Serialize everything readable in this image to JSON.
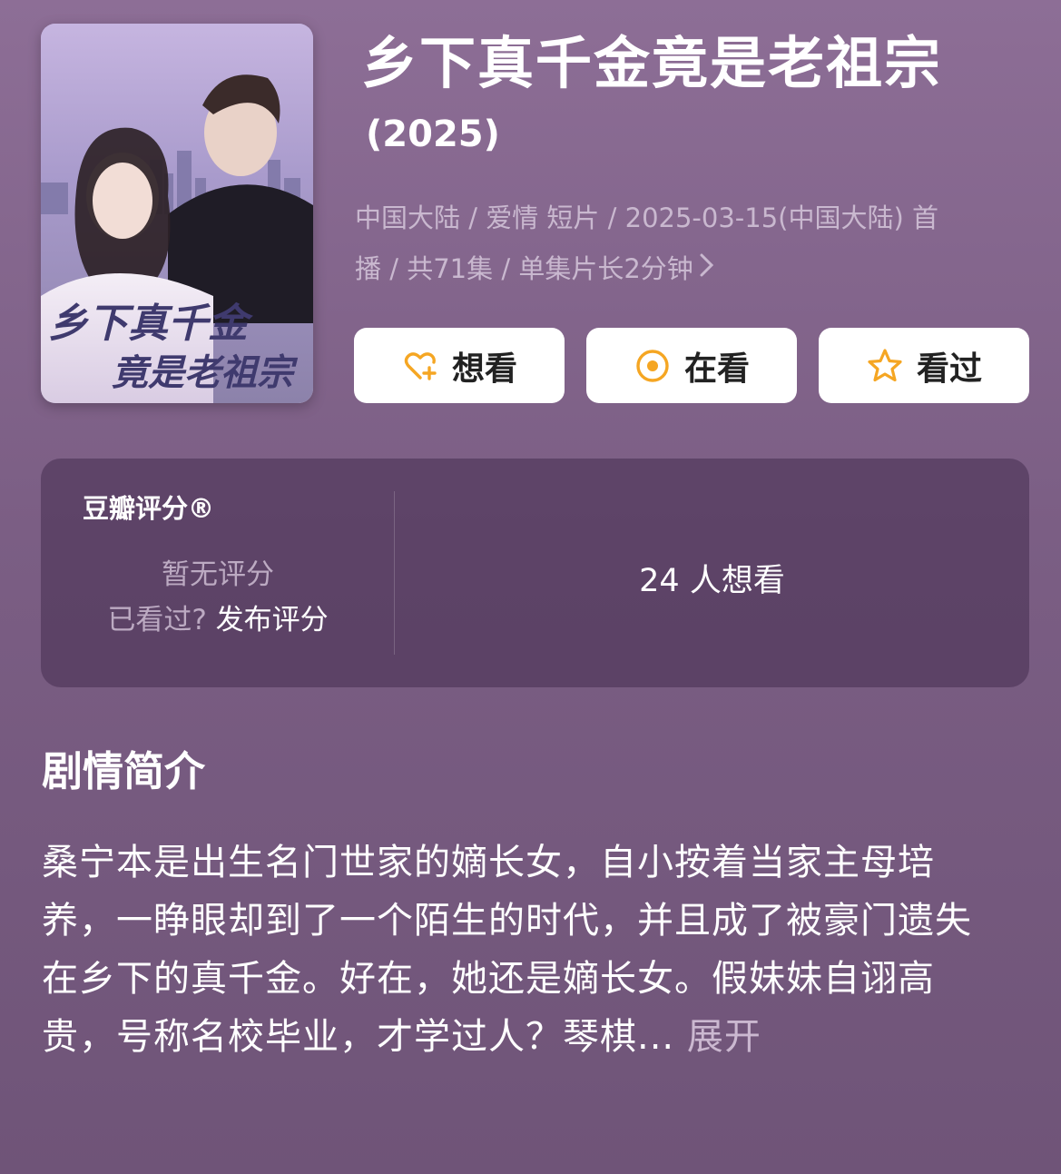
{
  "poster": {
    "title_line1": "乡下真千金",
    "title_line2": "竟是老祖宗"
  },
  "title": "乡下真千金竟是老祖宗",
  "year": "(2025)",
  "meta": {
    "line1": "中国大陆 / 爱情 短片 / 2025-03-15(中国大陆) 首",
    "line2": "播 / 共71集 / 单集片长2分钟"
  },
  "actions": {
    "want_label": "想看",
    "watching_label": "在看",
    "watched_label": "看过",
    "icon_color": "#f5a623"
  },
  "rating": {
    "label": "豆瓣评分®",
    "none_text": "暂无评分",
    "prompt": "已看过?",
    "rate_link": "发布评分",
    "want_count": "24 人想看"
  },
  "synopsis": {
    "heading": "剧情简介",
    "text": "桑宁本是出生名门世家的嫡长女，自小按着当家主母培养，一睁眼却到了一个陌生的时代，并且成了被豪门遗失在乡下的真千金。好在，她还是嫡长女。假妹妹自诩高贵，号称名校毕业，才学过人？琴棋...",
    "expand_label": "展开"
  }
}
